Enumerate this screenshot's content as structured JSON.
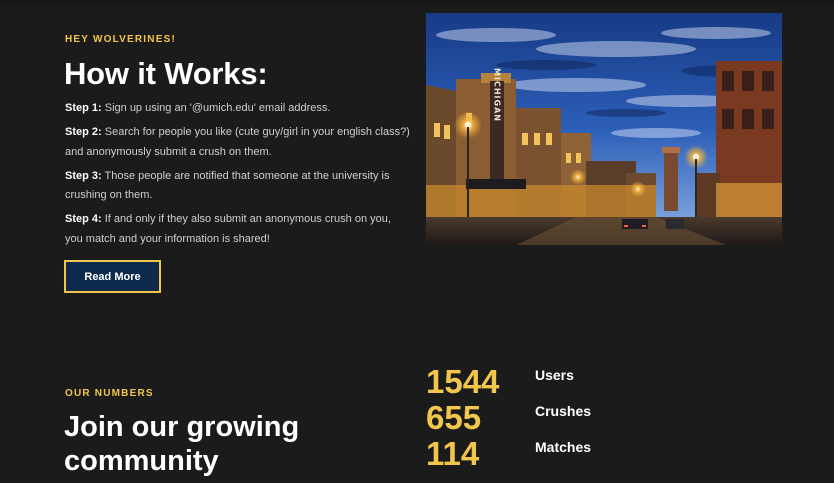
{
  "how": {
    "eyebrow": "HEY WOLVERINES!",
    "title": "How it Works:",
    "steps": [
      {
        "label": "Step 1:",
        "text": " Sign up using an '@umich.edu' email address."
      },
      {
        "label": "Step 2:",
        "text": " Search for people you like (cute guy/girl in your english class?) and anonymously submit a crush on them."
      },
      {
        "label": "Step 3:",
        "text": " Those people are notified that someone at the university is crushing on them."
      },
      {
        "label": "Step 4:",
        "text": " If and only if they also submit an anonymous crush on you, you match and your information is shared!"
      }
    ],
    "read_more_label": "Read More"
  },
  "photo": {
    "marquee_text": "MICHIGAN",
    "colors": {
      "sky": "#2c5fb8",
      "glow": "#f6b23c"
    }
  },
  "numbers": {
    "eyebrow": "OUR NUMBERS",
    "headline": "Join our growing community",
    "stats": [
      {
        "value": "1544",
        "label": "Users"
      },
      {
        "value": "655",
        "label": "Crushes"
      },
      {
        "value": "114",
        "label": "Matches"
      }
    ]
  },
  "colors": {
    "accent": "#f2c64b",
    "button_bg": "#0d2a4d",
    "background": "#1b1b1b"
  }
}
